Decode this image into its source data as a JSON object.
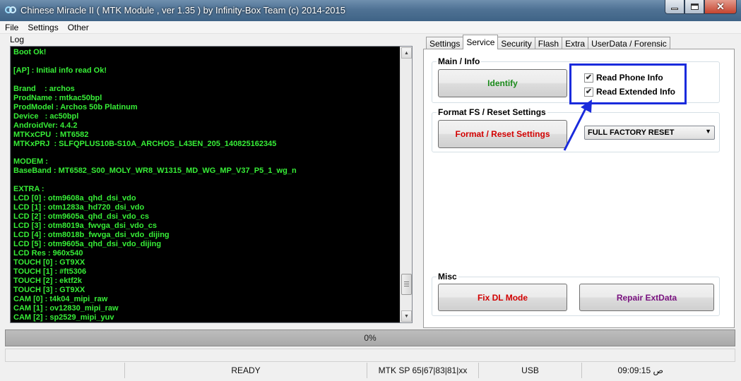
{
  "window": {
    "title": "Chinese Miracle II ( MTK Module , ver 1.35 ) by Infinity-Box Team (c) 2014-2015",
    "close_glyph": "✕"
  },
  "menu": [
    "File",
    "Settings",
    "Other"
  ],
  "log": {
    "label": "Log",
    "lines": [
      "Boot Ok!",
      "",
      "[AP] : Initial info read Ok!",
      "",
      "Brand    : archos",
      "ProdName : mtkac50bpl",
      "ProdModel : Archos 50b Platinum",
      "Device   : ac50bpl",
      "AndroidVer: 4.4.2",
      "MTKxCPU  : MT6582",
      "MTKxPRJ  : SLFQPLUS10B-S10A_ARCHOS_L43EN_205_140825162345",
      "",
      "MODEM :",
      "BaseBand : MT6582_S00_MOLY_WR8_W1315_MD_WG_MP_V37_P5_1_wg_n",
      "",
      "EXTRA :",
      "LCD [0] : otm9608a_qhd_dsi_vdo",
      "LCD [1] : otm1283a_hd720_dsi_vdo",
      "LCD [2] : otm9605a_qhd_dsi_vdo_cs",
      "LCD [3] : otm8019a_fwvga_dsi_vdo_cs",
      "LCD [4] : otm8018b_fwvga_dsi_vdo_dijing",
      "LCD [5] : otm9605a_qhd_dsi_vdo_dijing",
      "LCD Res : 960x540",
      "TOUCH [0] : GT9XX",
      "TOUCH [1] : #ft5306",
      "TOUCH [2] : ektf2k",
      "TOUCH [3] : GT9XX",
      "CAM [0] : t4k04_mipi_raw",
      "CAM [1] : ov12830_mipi_raw",
      "CAM [2] : sp2529_mipi_yuv"
    ]
  },
  "tabs": [
    {
      "label": "Settings",
      "active": false
    },
    {
      "label": "Service",
      "active": true
    },
    {
      "label": "Security",
      "active": false
    },
    {
      "label": "Flash",
      "active": false
    },
    {
      "label": "Extra",
      "active": false
    },
    {
      "label": "UserData / Forensic",
      "active": false
    }
  ],
  "main_info": {
    "title": "Main / Info",
    "identify_label": "Identify",
    "read_phone_info": {
      "label": "Read Phone Info",
      "checked": true
    },
    "read_extended_info": {
      "label": "Read Extended Info",
      "checked": true
    }
  },
  "format": {
    "title": "Format FS / Reset Settings",
    "button_label": "Format / Reset Settings",
    "mode_selected": "FULL FACTORY RESET"
  },
  "misc": {
    "title": "Misc",
    "fix_dl_label": "Fix DL Mode",
    "repair_ext_label": "Repair ExtData"
  },
  "progress": {
    "text": "0%",
    "value": 0
  },
  "status": {
    "state": "READY",
    "ports": "MTK SP 65|67|83|81|xx",
    "connection": "USB",
    "time": "09:09:15 ص"
  },
  "colors": {
    "log_text": "#37ee37",
    "identify_text": "#1a8a1a",
    "danger_text": "#d20000",
    "repair_text": "#7a1380",
    "highlight": "#1a2bdc"
  }
}
